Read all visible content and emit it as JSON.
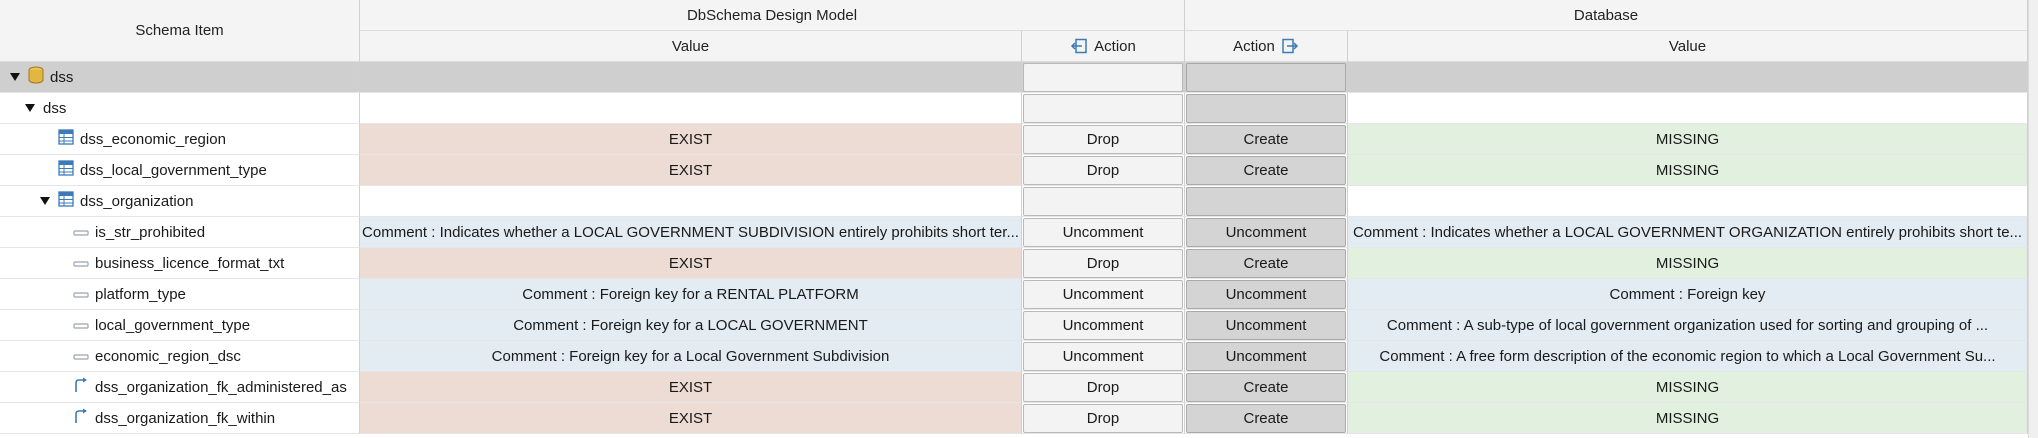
{
  "headers": {
    "schema_item": "Schema Item",
    "design_model": "DbSchema Design Model",
    "database": "Database",
    "value": "Value",
    "action": "Action"
  },
  "rows": [
    {
      "indent": 0,
      "expand": true,
      "icon": "database-icon",
      "label": "dss",
      "group": true,
      "design_value": "",
      "design_action": "",
      "db_action": "",
      "db_value": "",
      "type": "group"
    },
    {
      "indent": 1,
      "expand": true,
      "icon": "",
      "label": "dss",
      "group": false,
      "design_value": "",
      "design_action": "",
      "db_action": "",
      "db_value": "",
      "type": "blank"
    },
    {
      "indent": 2,
      "expand": false,
      "icon": "table-icon",
      "label": "dss_economic_region",
      "design_value": "EXIST",
      "design_action": "Drop",
      "db_action": "Create",
      "db_value": "MISSING",
      "type": "exist"
    },
    {
      "indent": 2,
      "expand": false,
      "icon": "table-icon",
      "label": "dss_local_government_type",
      "design_value": "EXIST",
      "design_action": "Drop",
      "db_action": "Create",
      "db_value": "MISSING",
      "type": "exist"
    },
    {
      "indent": 2,
      "expand": true,
      "icon": "table-icon",
      "label": "dss_organization",
      "design_value": "",
      "design_action": "",
      "db_action": "",
      "db_value": "",
      "type": "blank"
    },
    {
      "indent": 3,
      "expand": false,
      "icon": "column-icon",
      "label": "is_str_prohibited",
      "design_value": "Comment : Indicates whether a LOCAL GOVERNMENT SUBDIVISION entirely prohibits short ter...",
      "design_action": "Uncomment",
      "db_action": "Uncomment",
      "db_value": "Comment : Indicates whether a LOCAL GOVERNMENT ORGANIZATION entirely prohibits short te...",
      "type": "comment"
    },
    {
      "indent": 3,
      "expand": false,
      "icon": "column-icon",
      "label": "business_licence_format_txt",
      "design_value": "EXIST",
      "design_action": "Drop",
      "db_action": "Create",
      "db_value": "MISSING",
      "type": "exist"
    },
    {
      "indent": 3,
      "expand": false,
      "icon": "column-icon",
      "label": "platform_type",
      "design_value": "Comment : Foreign key for a RENTAL PLATFORM",
      "design_action": "Uncomment",
      "db_action": "Uncomment",
      "db_value": "Comment : Foreign key",
      "type": "comment"
    },
    {
      "indent": 3,
      "expand": false,
      "icon": "column-icon",
      "label": "local_government_type",
      "design_value": "Comment : Foreign key for a LOCAL GOVERNMENT",
      "design_action": "Uncomment",
      "db_action": "Uncomment",
      "db_value": "Comment : A sub-type of local government organization used for sorting and grouping of ...",
      "type": "comment"
    },
    {
      "indent": 3,
      "expand": false,
      "icon": "column-icon",
      "label": "economic_region_dsc",
      "design_value": "Comment : Foreign key for a Local Government Subdivision",
      "design_action": "Uncomment",
      "db_action": "Uncomment",
      "db_value": "Comment : A free form description of the economic region to which a Local Government Su...",
      "type": "comment"
    },
    {
      "indent": 3,
      "expand": false,
      "icon": "foreign-key-icon",
      "label": "dss_organization_fk_administered_as",
      "design_value": "EXIST",
      "design_action": "Drop",
      "db_action": "Create",
      "db_value": "MISSING",
      "type": "exist"
    },
    {
      "indent": 3,
      "expand": false,
      "icon": "foreign-key-icon",
      "label": "dss_organization_fk_within",
      "design_value": "EXIST",
      "design_action": "Drop",
      "db_action": "Create",
      "db_value": "MISSING",
      "type": "exist"
    }
  ],
  "colors": {
    "exist_bg": "#ecdcd3",
    "missing_bg": "#e2f0df",
    "comment_bg": "#e3ebf3",
    "group_bg": "#cfcfcf",
    "icon_blue": "#3d7ab8"
  }
}
